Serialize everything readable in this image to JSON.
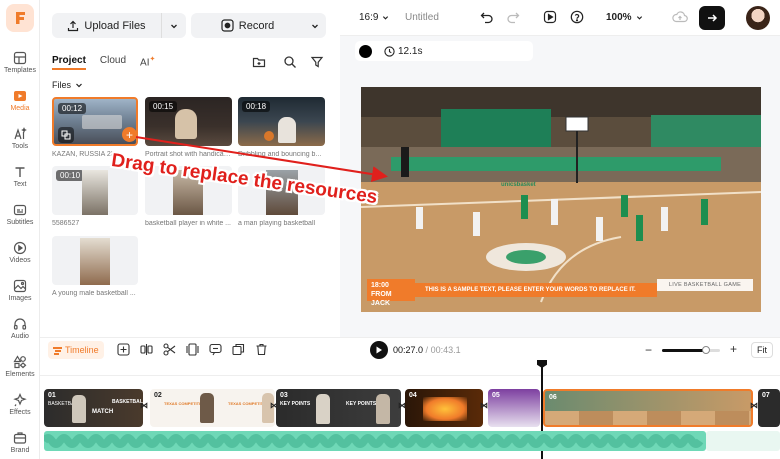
{
  "rail": {
    "items": [
      {
        "label": "Templates",
        "icon": "templates-icon"
      },
      {
        "label": "Media",
        "icon": "media-icon",
        "active": true
      },
      {
        "label": "Tools",
        "icon": "ai-tools-icon"
      },
      {
        "label": "Text",
        "icon": "text-icon"
      },
      {
        "label": "Subtitles",
        "icon": "subtitles-icon"
      },
      {
        "label": "Videos",
        "icon": "videos-icon"
      },
      {
        "label": "Images",
        "icon": "images-icon"
      },
      {
        "label": "Audio",
        "icon": "audio-icon"
      },
      {
        "label": "Elements",
        "icon": "elements-icon"
      },
      {
        "label": "Effects",
        "icon": "effects-icon"
      },
      {
        "label": "Brand",
        "icon": "brand-icon"
      }
    ]
  },
  "panel": {
    "upload_label": "Upload Files",
    "record_label": "Record",
    "tabs": [
      "Project",
      "Cloud",
      "AI"
    ],
    "files_label": "Files",
    "media": [
      {
        "duration": "00:12",
        "caption": "KAZAN, RUSSIA 23..."
      },
      {
        "duration": "00:15",
        "caption": "Portrait shot with handicap..."
      },
      {
        "duration": "00:18",
        "caption": "Dribbling and bouncing b..."
      },
      {
        "duration": "00:10",
        "caption": "5586527"
      },
      {
        "duration": "",
        "caption": "basketball player in white ..."
      },
      {
        "duration": "",
        "caption": "a man playing basketball"
      },
      {
        "duration": "",
        "caption": "A young male basketball ..."
      }
    ]
  },
  "topbar": {
    "ratio": "16:9",
    "title": "Untitled",
    "zoom": "100%"
  },
  "preview": {
    "duration_chip": "12.1s",
    "lower_third_time": "18:00",
    "lower_third_name": "FROM JACK",
    "lower_third_text": "THIS IS A SAMPLE TEXT, PLEASE ENTER YOUR WORDS TO REPLACE IT.",
    "lower_third_tag": "LIVE BASKETBALL GAME",
    "arena_sign": "unicsbasket"
  },
  "annotation": "Drag to replace the resources",
  "timeline": {
    "label": "Timeline",
    "current_time": "00:27.0",
    "total_time": "00:43.1",
    "fit_label": "Fit",
    "zoom_level": 0.75,
    "clips": [
      {
        "num": "01",
        "title": "BASKETBALL",
        "sub": "MATCH"
      },
      {
        "num": "02",
        "title": "TEXAS COMPETITION",
        "sub": ""
      },
      {
        "num": "03",
        "title": "KEY POINTS",
        "sub": "KEY POINTS"
      },
      {
        "num": "04",
        "title": "",
        "sub": ""
      },
      {
        "num": "05",
        "title": "",
        "sub": ""
      },
      {
        "num": "06",
        "title": "",
        "sub": ""
      },
      {
        "num": "07",
        "title": "",
        "sub": ""
      }
    ]
  },
  "colors": {
    "accent": "#f07b2a",
    "audio": "#6fd8b7",
    "annotation": "#e0201c"
  }
}
